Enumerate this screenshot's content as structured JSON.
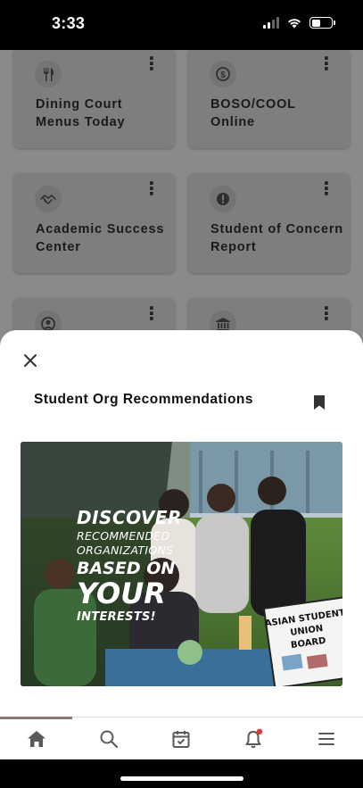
{
  "status_bar": {
    "time": "3:33",
    "battery_level": 0.45
  },
  "tiles": [
    {
      "label": "Dining Court Menus Today",
      "icon": "utensils-icon"
    },
    {
      "label": "BOSO/COOL Online",
      "icon": "dollar-icon"
    },
    {
      "label": "Academic Success Center",
      "icon": "handshake-icon"
    },
    {
      "label": "Student of Concern Report",
      "icon": "alert-icon"
    },
    {
      "label": "",
      "icon": "user-circle-icon"
    },
    {
      "label": "",
      "icon": "building-icon"
    }
  ],
  "sheet": {
    "title": "Student Org Recommendations",
    "promo": {
      "line1": "DISCOVER",
      "line2": "RECOMMENDED",
      "line3": "ORGANIZATIONS",
      "line4": "BASED ON",
      "line5": "YOUR",
      "line6": "INTERESTS!",
      "sign_line1": "ASIAN STUDENT",
      "sign_line2": "UNION",
      "sign_line3": "BOARD"
    }
  },
  "bottom_nav": {
    "items": [
      "home-icon",
      "search-icon",
      "calendar-check-icon",
      "bell-icon",
      "menu-icon"
    ],
    "active": "home-icon",
    "notification_dot_color": "#e53935"
  },
  "colors": {
    "accent": "#8a7a70",
    "overlay": "#8a8a8a",
    "sheet": "#ffffff"
  }
}
